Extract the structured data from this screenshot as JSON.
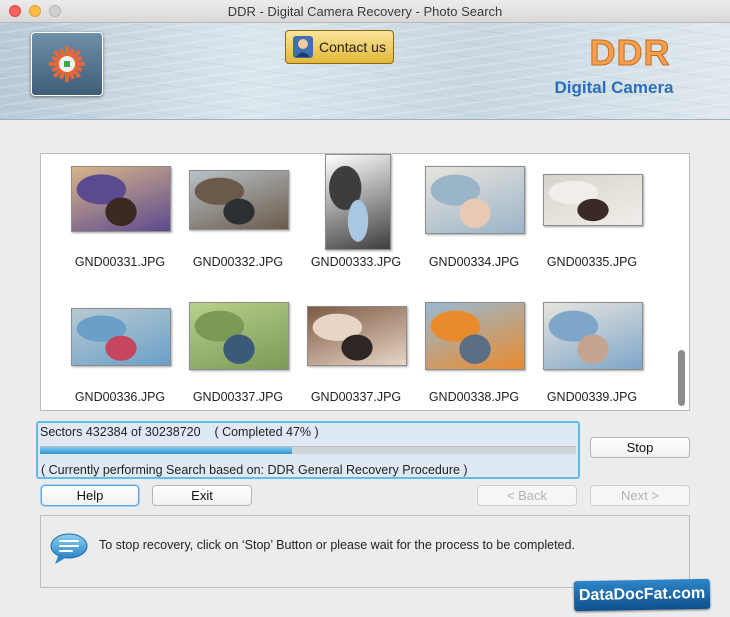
{
  "window": {
    "title": "DDR - Digital Camera Recovery - Photo Search"
  },
  "header": {
    "contact_label": "Contact us",
    "brand_title": "DDR",
    "brand_subtitle": "Digital Camera"
  },
  "files": [
    {
      "name": "GND00331.JPG",
      "thumb": {
        "colors": [
          "#d9b48a",
          "#5b4a8e",
          "#3a2a22"
        ]
      }
    },
    {
      "name": "GND00332.JPG",
      "thumb": {
        "colors": [
          "#b7c2c7",
          "#6b5a4a",
          "#2c2f33"
        ]
      }
    },
    {
      "name": "GND00333.JPG",
      "thumb": {
        "colors": [
          "#ffffff",
          "#3d3d3d",
          "#a9c7e0"
        ]
      }
    },
    {
      "name": "GND00334.JPG",
      "thumb": {
        "colors": [
          "#e8e4dc",
          "#9ab4c8",
          "#e7c9b6"
        ]
      }
    },
    {
      "name": "GND00335.JPG",
      "thumb": {
        "colors": [
          "#d8d3cc",
          "#f1ede8",
          "#3a2a25"
        ]
      }
    },
    {
      "name": "GND00336.JPG",
      "thumb": {
        "colors": [
          "#b8c9d1",
          "#6aa0c8",
          "#c7455e"
        ]
      }
    },
    {
      "name": "GND00337.JPG",
      "thumb": {
        "colors": [
          "#b8d08a",
          "#7b9a55",
          "#3a5a7a"
        ]
      }
    },
    {
      "name": "GND00337.JPG",
      "thumb": {
        "colors": [
          "#7d5a44",
          "#e8d5c5",
          "#2d2623"
        ]
      }
    },
    {
      "name": "GND00338.JPG",
      "thumb": {
        "colors": [
          "#98b9d4",
          "#e98b2d",
          "#5a6e83"
        ]
      }
    },
    {
      "name": "GND00339.JPG",
      "thumb": {
        "colors": [
          "#e8e4de",
          "#7ea6c9",
          "#c6a38e"
        ]
      }
    }
  ],
  "progress": {
    "status_text": "Sectors 432384 of 30238720    ( Completed 47% )",
    "percent": 47,
    "procedure_text": "( Currently performing Search based on: DDR General Recovery Procedure )"
  },
  "buttons": {
    "stop": "Stop",
    "help": "Help",
    "exit": "Exit",
    "back": "< Back",
    "next": "Next >"
  },
  "info": {
    "message": "To stop recovery, click on ‘Stop’ Button or please wait for the process to be completed."
  },
  "watermark": "DataDocFat.com"
}
